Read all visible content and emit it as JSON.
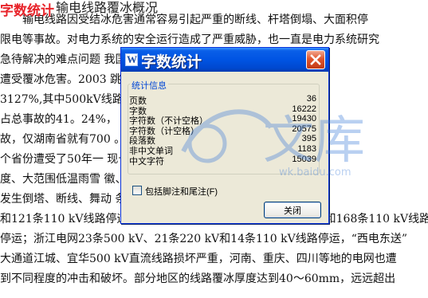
{
  "document": {
    "overlay_title": "字数统计",
    "heading_fragment": "输电线路覆冰概况",
    "lines": [
      "　　输电线路因受结冰危害通常容易引起严重的断线、杆塔倒塌、大面积停",
      "限电等事故。对电力系统的安全运行造成了严重威胁，也一直是电力系统研究",
      "急待解决的难点问题                                    我国输电线路便不",
      "遭受覆冰危害。2003                                    跳闸79次，占总事故",
      "3127%,其中500kV线路                                    线路非计划停运47次，",
      "占总事故的41。24%，                                    网出现大面积冰灾",
      "故，仅湖南省就有700                                    。2008年1月，南方",
      "个省份遭受了50年一                                    现长时间持续的大",
      "度、大范围低温雨雪                                    徽、湖北等地的电",
      "发生倒塔、断线、舞动                                    条500 kV、44条220 kV",
      "和121条110 kV线路停运；江西电网17条500 kV、57条220 kV和168条110 kV线路",
      "停运；浙江电网23条500 kV、21条220 kV和14条110 kV线路停运，“西电东送”",
      "大通道江城、宜华500 kV直流线路损坏严重，河南、重庆、四川等地的电网也遭",
      "到不同程度的冲击和破坏。部分地区的线路覆冰厚度达到40～60mm，远远超出"
    ]
  },
  "dialog": {
    "title": "字数统计",
    "title_icon_letter": "W",
    "group_title": "统计信息",
    "stats": [
      {
        "label": "页数",
        "value": "36"
      },
      {
        "label": "字数",
        "value": "16222"
      },
      {
        "label": "字符数（不计空格）",
        "value": "19430"
      },
      {
        "label": "字符数（计空格）",
        "value": "20575"
      },
      {
        "label": "段落数",
        "value": "395"
      },
      {
        "label": "非中文单词",
        "value": "1183"
      },
      {
        "label": "中文字符",
        "value": "15039"
      }
    ],
    "checkbox_label": "包括脚注和尾注(F)",
    "checkbox_checked": false,
    "close_button_label": "关闭"
  },
  "watermark": {
    "text": "文库",
    "subtext": "wk.baidu.com"
  },
  "colors": {
    "titlebar": "#0054e3",
    "overlay_title": "#e8232a",
    "group_title": "#0046d5"
  }
}
